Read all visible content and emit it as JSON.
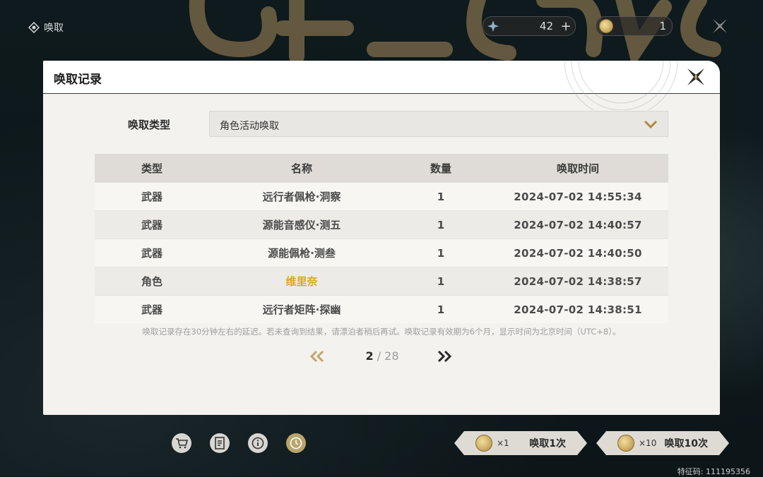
{
  "top_bar": {
    "title": "唤取",
    "currency_star": {
      "value": "42",
      "plus": "+"
    },
    "currency_coin": {
      "value": "1"
    }
  },
  "modal": {
    "title": "唤取记录",
    "filter": {
      "label": "唤取类型",
      "selected": "角色活动唤取"
    },
    "table": {
      "headers": [
        "类型",
        "名称",
        "数量",
        "唤取时间"
      ],
      "rows": [
        {
          "type": "武器",
          "name": "远行者佩枪·洞察",
          "qty": "1",
          "time": "2024-07-02 14:55:34",
          "highlight": false
        },
        {
          "type": "武器",
          "name": "源能音感仪·测五",
          "qty": "1",
          "time": "2024-07-02 14:40:57",
          "highlight": false
        },
        {
          "type": "武器",
          "name": "源能佩枪·测叁",
          "qty": "1",
          "time": "2024-07-02 14:40:50",
          "highlight": false
        },
        {
          "type": "角色",
          "name": "维里奈",
          "qty": "1",
          "time": "2024-07-02 14:38:57",
          "highlight": true
        },
        {
          "type": "武器",
          "name": "远行者矩阵·探幽",
          "qty": "1",
          "time": "2024-07-02 14:38:51",
          "highlight": false
        }
      ]
    },
    "note": "唤取记录存在30分钟左右的延迟。若未查询到结果，请漂泊者稍后再试。唤取记录有效期为6个月，显示时间为北京时间（UTC+8）。",
    "pager": {
      "current": "2",
      "separator": " / ",
      "total": "28"
    }
  },
  "bottom": {
    "pull_one": {
      "multiplier": "×1",
      "label": "唤取1次"
    },
    "pull_ten": {
      "multiplier": "×10",
      "label": "唤取10次"
    },
    "feature_code": "特征码: 111195356"
  },
  "colors": {
    "highlight_gold": "#d9a91e",
    "accent_gold": "#b9a56c"
  }
}
